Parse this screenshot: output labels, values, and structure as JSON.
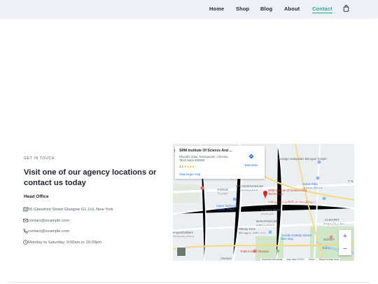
{
  "nav": {
    "items": [
      {
        "label": "Home"
      },
      {
        "label": "Shop"
      },
      {
        "label": "Blog"
      },
      {
        "label": "About"
      },
      {
        "label": "Contact",
        "active": true
      }
    ],
    "cart_icon": "shopping-bag-icon"
  },
  "contact": {
    "eyebrow": "GET IN TOUCH",
    "heading": "Visit one of our agency locations or contact us today",
    "subheading": "Head Office",
    "address": "56 Glassford Street Glasgow G1 1UL New York",
    "email": "contact@example.com",
    "phone": "contact@example.com",
    "hours": "Monday to Saturday: 9:00am to 16:00pm",
    "icons": [
      "map-icon",
      "envelope-icon",
      "phone-icon",
      "clock-icon"
    ]
  },
  "map": {
    "card": {
      "title": "SRM Institute Of Science And ...",
      "address": "Bharathi Salai, Ramapuram, Chennai, Tamil Nadu 600089",
      "rating": "4.1",
      "stars": "★★★★☆",
      "larger_map": "View larger map",
      "directions": "Directions"
    },
    "marker_label": "SRM Institute Of Science And Technology",
    "marker_label_local": "எஸ்ஆர்எம் அறிவியல் தொழில்நுட்ப",
    "labels": {
      "arumigu": "Arumigu Vadapalani Murugan Temple",
      "ashok_pillar": "Ashok Pillar",
      "ashok_pillar_local": "அசோக் பில்லர்",
      "t_nagar": "T. N",
      "valasaravakkam": "VALASARAVAKKAM",
      "valasaravakkam_local": "வளசரவாக்கம்",
      "porur": "PORUR",
      "porur_local": "போரூர்",
      "super_saravana": "Super Saravana Stores - Porur",
      "ramapuram": "RAMAPURAM",
      "ramapuram_local": "ராமாபுரம்",
      "saidapet": "SAIDAPET",
      "saidapet_local": "சைதாப்பேட்டை",
      "manapakkam": "MANAPAKKAM",
      "manapakkam_local": "மணப்பாக்கம்",
      "military": "Military Zone",
      "military_local": "இராணுவ மண்டலம்",
      "gerugambakkam": "erugambakkam",
      "gerugambakkam_local": "கெருகம்பாக்கம்",
      "guindy_station": "Guindy Railway Station Bus Stop",
      "guindy": "GUINDY",
      "guindy_local": "கிண்டி",
      "trident": "Trident Hotel Chennai",
      "chennai": "Chennai",
      "guindy_park": "Gu Na"
    },
    "zoom_in": "+",
    "zoom_out": "−",
    "attribution": [
      "Keyboard shortcuts",
      "Map data ©2022",
      "Terms",
      "Report a map error"
    ]
  }
}
